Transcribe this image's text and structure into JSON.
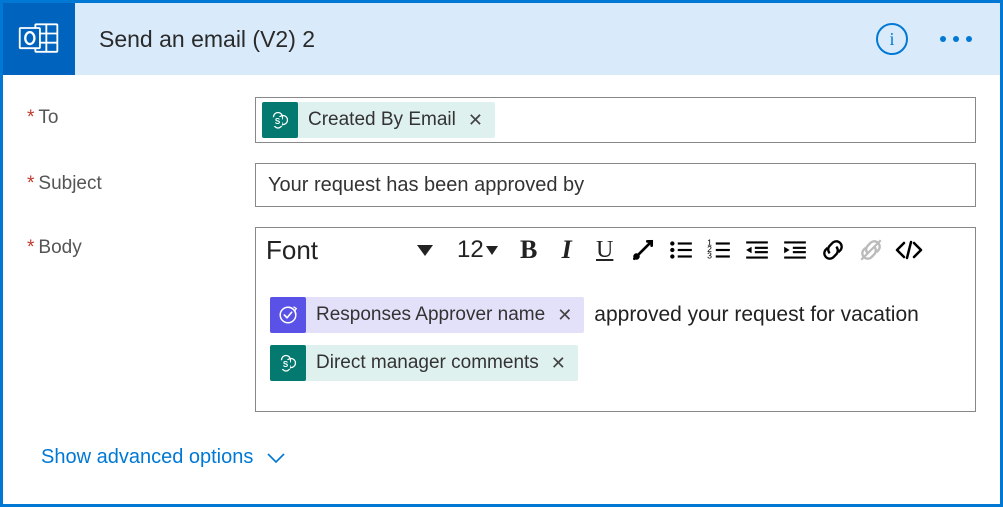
{
  "header": {
    "title": "Send an email (V2) 2",
    "connector_icon": "outlook-icon"
  },
  "fields": {
    "to": {
      "label": "To",
      "required": true,
      "tokens": [
        {
          "icon_type": "sharepoint",
          "label": "Created By Email"
        }
      ]
    },
    "subject": {
      "label": "Subject",
      "required": true,
      "value": "Your request has been approved by"
    },
    "body": {
      "label": "Body",
      "required": true,
      "toolbar": {
        "font": "Font",
        "size": "12"
      },
      "content": [
        {
          "type": "line",
          "parts": [
            {
              "type": "token",
              "icon_type": "approval",
              "label": "Responses Approver name"
            },
            {
              "type": "text",
              "text": "approved your request for vacation"
            }
          ]
        },
        {
          "type": "line",
          "parts": [
            {
              "type": "token",
              "icon_type": "sharepoint",
              "label": "Direct manager comments"
            }
          ]
        }
      ]
    }
  },
  "footer": {
    "show_advanced": "Show advanced options"
  }
}
